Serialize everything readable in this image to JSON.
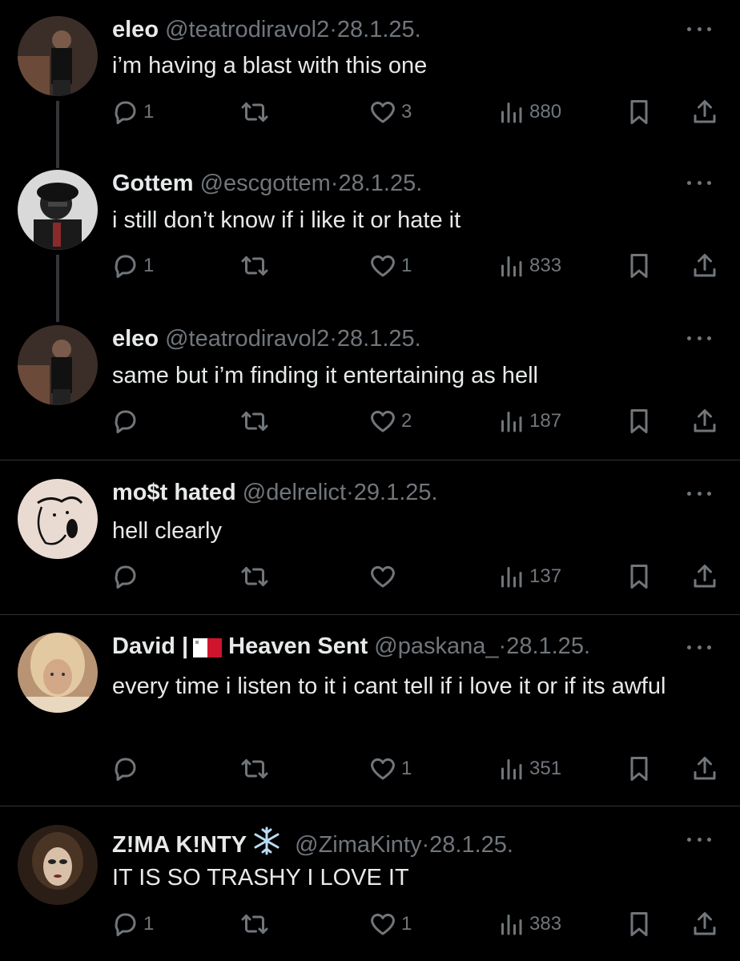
{
  "posts": [
    {
      "name": "eleo",
      "name_parts": [
        "eleo",
        ""
      ],
      "handle": "@teatrodiravol2",
      "separator": "·",
      "date": "28.1.25.",
      "text": "i’m having a blast with this one",
      "replies": "1",
      "reposts": "",
      "likes": "3",
      "views": "880",
      "avatar_colors": [
        "#2a2320",
        "#6b4a3a"
      ]
    },
    {
      "name": "Gottem",
      "name_parts": [
        "Gottem",
        ""
      ],
      "handle": "@escgottem",
      "separator": "·",
      "date": "28.1.25.",
      "text": "i still don’t know if i like it or hate it",
      "replies": "1",
      "reposts": "",
      "likes": "1",
      "views": "833",
      "avatar_colors": [
        "#1a1a1a",
        "#555555"
      ]
    },
    {
      "name": "eleo",
      "name_parts": [
        "eleo",
        ""
      ],
      "handle": "@teatrodiravol2",
      "separator": "·",
      "date": "28.1.25.",
      "text": "same but i’m finding it entertaining as hell",
      "replies": "",
      "reposts": "",
      "likes": "2",
      "views": "187",
      "avatar_colors": [
        "#2a2320",
        "#6b4a3a"
      ]
    },
    {
      "name": "mo$t hated",
      "name_parts": [
        "mo$t hated",
        ""
      ],
      "handle": "@delrelict",
      "separator": "·",
      "date": "29.1.25.",
      "text": "hell clearly",
      "replies": "",
      "reposts": "",
      "likes": "",
      "views": "137",
      "avatar_colors": [
        "#e8d6cc",
        "#111111"
      ]
    },
    {
      "name": "David | Heaven Sent",
      "name_parts": [
        "David |",
        "Heaven Sent"
      ],
      "handle": "@paskana_",
      "separator": "·",
      "date": "28.1.25.",
      "text": "every time i listen to it i cant tell if i love it or if its awful",
      "replies": "",
      "reposts": "",
      "likes": "1",
      "views": "351",
      "avatar_colors": [
        "#c9a27a",
        "#e9d3b0"
      ]
    },
    {
      "name": "Z!MA K!NTY",
      "name_parts": [
        "Z!MA K!NTY",
        ""
      ],
      "handle": "@ZimaKinty",
      "separator": "·",
      "date": "28.1.25.",
      "text": "IT IS SO TRASHY I LOVE IT",
      "replies": "1",
      "reposts": "",
      "likes": "1",
      "views": "383",
      "avatar_colors": [
        "#3a2a1e",
        "#d8c0a8"
      ]
    }
  ],
  "icons": {
    "reply": "reply-icon",
    "repost": "repost-icon",
    "like": "heart-icon",
    "views": "views-icon",
    "bookmark": "bookmark-icon",
    "share": "share-icon",
    "more": "more-icon",
    "flag": "malta-flag-icon",
    "snowflake": "snowflake-icon"
  },
  "colors": {
    "background": "#000000",
    "text": "#e7e9ea",
    "muted": "#71767b",
    "divider": "#2f3336",
    "thread_line": "#333639"
  }
}
